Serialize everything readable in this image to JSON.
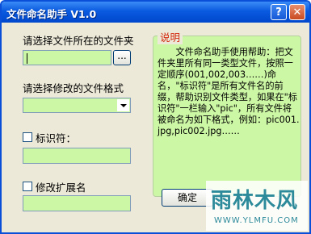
{
  "window": {
    "title": "文件命名助手 V1.0",
    "help_glyph": "?",
    "close_glyph": "✕"
  },
  "folder": {
    "label": "请选择文件所在的文件夹",
    "value": "",
    "browse_label": "..."
  },
  "format": {
    "label": "请选择修改的文件格式",
    "selected": ""
  },
  "identifier": {
    "label": "标识符：",
    "checked": false,
    "value": ""
  },
  "extension": {
    "label": "修改扩展名",
    "checked": false,
    "value": ""
  },
  "help": {
    "title": "说明",
    "text": "　　文件命名助手使用帮助：把文件夹里所有同一类型文件，按照一定顺序(001,002,003……)命名，\"标识符\"是所有文件名的前缀，帮助识别文件类型，如果在\"标识符\"一栏输入\"pic\"，所有文件将被命名为如下格式，例如：pic001.jpg,pic002.jpg……"
  },
  "ok_button": {
    "label": "确定"
  },
  "watermark": {
    "name": "雨林木风",
    "url": "WWW.YLMFU.COM"
  },
  "colors": {
    "field_bg": "#ccf7a4",
    "titlebar": "#0a5ae0",
    "help_title": "#d32a0e"
  }
}
